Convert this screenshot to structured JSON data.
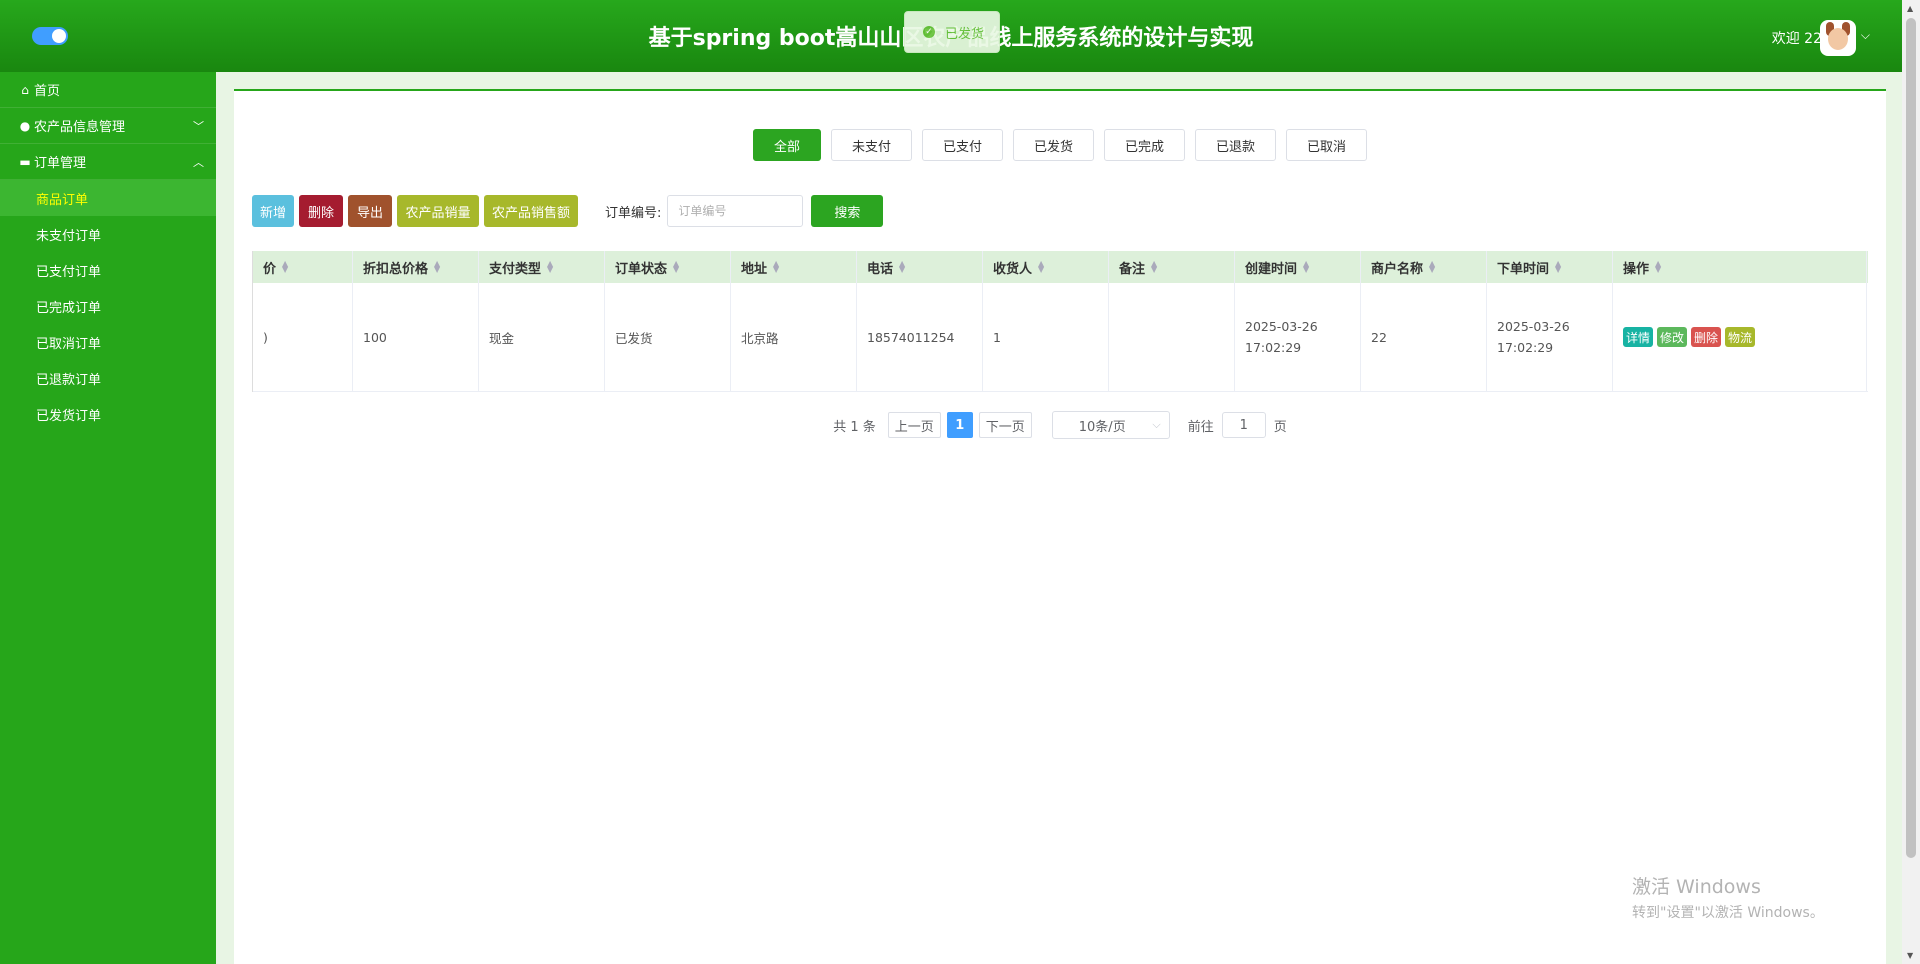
{
  "header": {
    "title": "基于spring boot嵩山山区农产品线上服务系统的设计与实现",
    "welcome": "欢迎 22",
    "caret": "⌵"
  },
  "toast": {
    "text": "已发货"
  },
  "sidebar": {
    "home": "首页",
    "groups": [
      {
        "label": "农产品信息管理"
      },
      {
        "label": "订单管理"
      }
    ],
    "sub_items": [
      "商品订单",
      "未支付订单",
      "已支付订单",
      "已完成订单",
      "已取消订单",
      "已退款订单",
      "已发货订单"
    ]
  },
  "tabs": [
    "全部",
    "未支付",
    "已支付",
    "已发货",
    "已完成",
    "已退款",
    "已取消"
  ],
  "toolbar": {
    "add": "新增",
    "delete": "删除",
    "export": "导出",
    "sales_volume": "农产品销量",
    "sales_amount": "农产品销售额",
    "search_label": "订单编号:",
    "search_placeholder": "订单编号",
    "search_button": "搜索"
  },
  "table": {
    "headers": [
      "价",
      "折扣总价格",
      "支付类型",
      "订单状态",
      "地址",
      "电话",
      "收货人",
      "备注",
      "创建时间",
      "商户名称",
      "下单时间",
      "操作"
    ],
    "row": {
      "price": ")",
      "discount_total": "100",
      "pay_type": "现金",
      "status": "已发货",
      "address": "北京路",
      "phone": "18574011254",
      "receiver": "1",
      "remark": "",
      "created": "2025-03-26 17:02:29",
      "merchant": "22",
      "ordered": "2025-03-26 17:02:29"
    },
    "actions": {
      "detail": "详情",
      "edit": "修改",
      "delete": "删除",
      "logistics": "物流"
    }
  },
  "pagination": {
    "total": "共 1 条",
    "prev": "上一页",
    "current": "1",
    "next": "下一页",
    "page_size": "10条/页",
    "goto": "前往",
    "goto_value": "1",
    "page_unit": "页"
  },
  "watermark": {
    "line1": "激活 Windows",
    "line2": "转到\"设置\"以激活 Windows。"
  },
  "colors": {
    "header": "#27a81c",
    "sidebar": "#26a61a",
    "active_tab": "#2ca521",
    "accent": "#409eff"
  }
}
